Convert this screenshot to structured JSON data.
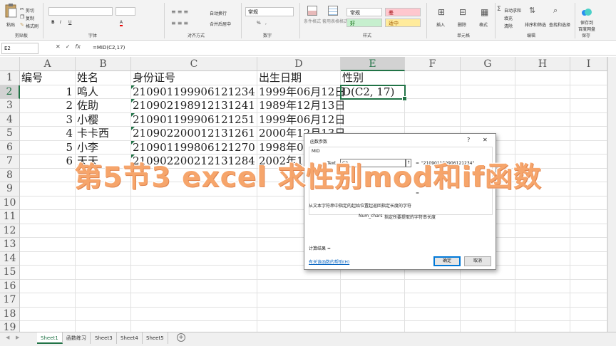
{
  "ribbon": {
    "clipboard": {
      "paste": "粘贴",
      "cut": "剪切",
      "copy": "复制",
      "format_painter": "格式刷",
      "group": "剪贴板"
    },
    "font": {
      "group": "字体",
      "bold": "B",
      "italic": "I",
      "underline": "U",
      "font_color_label": "A"
    },
    "alignment": {
      "wrap_text": "自动换行",
      "merge_center": "合并后居中",
      "group": "对齐方式"
    },
    "number": {
      "format": "常规",
      "percent": "%",
      "comma": ",",
      "group": "数字"
    },
    "styles": {
      "conditional": "条件格式",
      "table": "套用表格格式",
      "normal": "常规",
      "bad": "差",
      "good": "好",
      "neutral": "适中",
      "group": "样式"
    },
    "cells": {
      "insert": "插入",
      "delete": "删除",
      "format": "格式",
      "group": "单元格"
    },
    "editing": {
      "autosum": "自动求和",
      "fill": "填充",
      "clear": "清除",
      "sort_filter": "排序和筛选",
      "find_select": "查找和选择",
      "group": "编辑"
    },
    "save": {
      "label1": "保存到",
      "label2": "百度网盘",
      "group": "保存"
    }
  },
  "formula_bar": {
    "name_box": "E2",
    "formula": "=MID(C2,17)",
    "cancel": "✕",
    "enter": "✓",
    "fx": "fx"
  },
  "columns": [
    "A",
    "B",
    "C",
    "D",
    "E",
    "F",
    "G",
    "H",
    "I"
  ],
  "rows": [
    "1",
    "2",
    "3",
    "4",
    "5",
    "6",
    "7",
    "8",
    "9",
    "10",
    "11",
    "12",
    "13",
    "14",
    "15",
    "16",
    "17",
    "18",
    "19"
  ],
  "cells": {
    "header": [
      "编号",
      "姓名",
      "身份证号",
      "出生日期",
      "性别"
    ],
    "data": [
      {
        "no": "1",
        "name": "鸣人",
        "id": "210901199906121234",
        "birth": "1999年06月12日",
        "gender": "D(C2, 17)"
      },
      {
        "no": "2",
        "name": "佐助",
        "id": "210902198912131241",
        "birth": "1989年12月13日",
        "gender": ""
      },
      {
        "no": "3",
        "name": "小樱",
        "id": "210901199906121251",
        "birth": "1999年06月12日",
        "gender": ""
      },
      {
        "no": "4",
        "name": "卡卡西",
        "id": "210902200012131261",
        "birth": "2000年12月13日",
        "gender": ""
      },
      {
        "no": "5",
        "name": "小李",
        "id": "210901199806121270",
        "birth": "1998年06",
        "gender": ""
      },
      {
        "no": "6",
        "name": "天天",
        "id": "210902200212131284",
        "birth": "2002年12",
        "gender": ""
      }
    ]
  },
  "dialog": {
    "title": "函数参数",
    "help_q": "?",
    "close": "✕",
    "function_name": "MID",
    "arg1_label": "Text",
    "arg1_value": "C2",
    "arg1_result": "\"210901199906121234\"",
    "arg2_result": "17",
    "arg3_result": "",
    "eq": "=",
    "result_eq": "=",
    "description": "从文本字符串中指定的起始位置起返回指定长度的字符",
    "arg_help_name": "Num_chars",
    "arg_help_text": "指定所要提取的字符串长度",
    "result_label": "计算结果 =",
    "help_link": "有关该函数的帮助(H)",
    "ok": "确定",
    "cancel": "取消"
  },
  "sheet_tabs": [
    "Sheet1",
    "函数练习",
    "Sheet3",
    "Sheet4",
    "Sheet5"
  ],
  "add_sheet": "+",
  "overlay_title": "第5节3 excel 求性别mod和if函数",
  "colors": {
    "accent": "#217346",
    "banner": "#f6a56b",
    "dialog_blue": "#0078d7"
  }
}
